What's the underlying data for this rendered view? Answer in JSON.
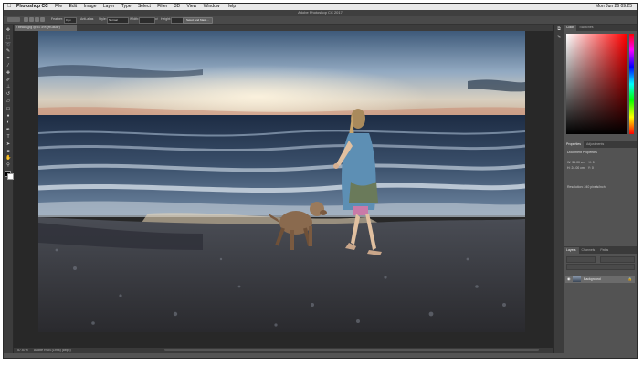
{
  "menubar": {
    "apple": "",
    "items": [
      "Photoshop CC",
      "File",
      "Edit",
      "Image",
      "Layer",
      "Type",
      "Select",
      "Filter",
      "3D",
      "View",
      "Window",
      "Help"
    ],
    "status": "Mon Jun 26  09:25"
  },
  "window": {
    "title": "Adobe Photoshop CC 2017"
  },
  "options_bar": {
    "feather_label": "Feather:",
    "feather_value": "0 px",
    "antialias_label": "Anti-alias",
    "style_label": "Style:",
    "style_value": "Normal",
    "width_label": "Width:",
    "height_label": "Height:",
    "select_mask_label": "Select and Mask..."
  },
  "document": {
    "tab_title": "beach.jpg @ 57.5% (RGB/8*)",
    "close_glyph": "×"
  },
  "status_bar": {
    "zoom": "57.57%",
    "doc_info": "Adobe RGB (1998) (8bpc)"
  },
  "panels": {
    "color_tabs": [
      "Color",
      "Swatches"
    ],
    "properties_tabs": [
      "Properties",
      "Adjustments"
    ],
    "document_properties": "Document Properties",
    "w_label": "W:",
    "w_value": "36.00 cm",
    "h_label": "H:",
    "h_value": "24.00 cm",
    "x_label": "X:",
    "x_value": "0",
    "y_label": "Y:",
    "y_value": "0",
    "resolution": "Resolution: 240 pixels/inch",
    "layers_tabs": [
      "Layers",
      "Channels",
      "Paths"
    ],
    "layer_name": "Background"
  },
  "colors": {
    "menubar_bg": "#e9e9e9",
    "app_bg": "#535353",
    "panel_dark": "#3c3c3c",
    "foreground_color": "#000000",
    "background_color": "#ffffff"
  },
  "icons": {
    "tools": [
      "move-icon",
      "marquee-icon",
      "lasso-icon",
      "quick-select-icon",
      "crop-icon",
      "eyedropper-icon",
      "healing-icon",
      "brush-icon",
      "clone-stamp-icon",
      "history-brush-icon",
      "eraser-icon",
      "gradient-icon",
      "blur-icon",
      "dodge-icon",
      "pen-icon",
      "type-icon",
      "path-select-icon",
      "shape-icon",
      "hand-icon",
      "zoom-icon",
      "more-tools-icon"
    ]
  }
}
